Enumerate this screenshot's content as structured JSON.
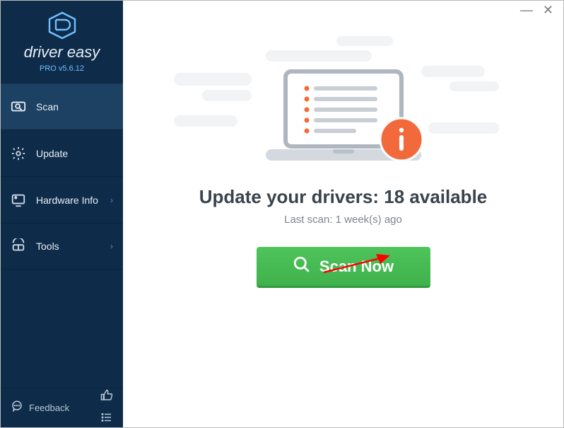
{
  "brand": {
    "name": "driver easy",
    "version": "PRO v5.6.12"
  },
  "sidebar": {
    "items": [
      {
        "label": "Scan"
      },
      {
        "label": "Update"
      },
      {
        "label": "Hardware Info"
      },
      {
        "label": "Tools"
      }
    ],
    "feedback_label": "Feedback"
  },
  "main": {
    "headline_prefix": "Update your drivers: ",
    "available_count": "18",
    "headline_suffix": " available",
    "last_scan_prefix": "Last scan: ",
    "last_scan_value": "1 week(s) ago",
    "scan_button": "Scan Now"
  },
  "colors": {
    "sidebar_bg": "#0e2c4a",
    "accent_green": "#4fc45a",
    "accent_orange": "#f26a3b"
  }
}
